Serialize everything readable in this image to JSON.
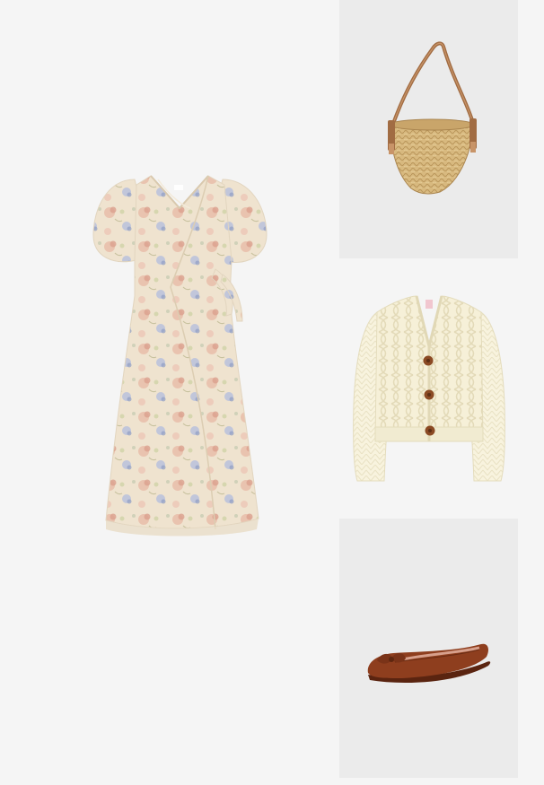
{
  "outfit": {
    "items": [
      {
        "id": "dress",
        "icon": "floral-wrap-dress-icon"
      },
      {
        "id": "bag",
        "icon": "straw-bucket-bag-icon"
      },
      {
        "id": "cardigan",
        "icon": "cable-knit-cardigan-icon"
      },
      {
        "id": "shoes",
        "icon": "suede-ballet-flat-icon"
      }
    ],
    "colors": {
      "background": "#f5f5f5",
      "panel_gray": "#ebebeb",
      "dress_base": "#efe3cf",
      "floral_pink": "#e7b9a8",
      "floral_blue": "#aab6d2",
      "straw": "#d6b57a",
      "leather_strap": "#8a5a3a",
      "cardigan": "#f7f2dc",
      "button_brown": "#8b4a24",
      "suede_brown": "#8e3e1e"
    }
  }
}
